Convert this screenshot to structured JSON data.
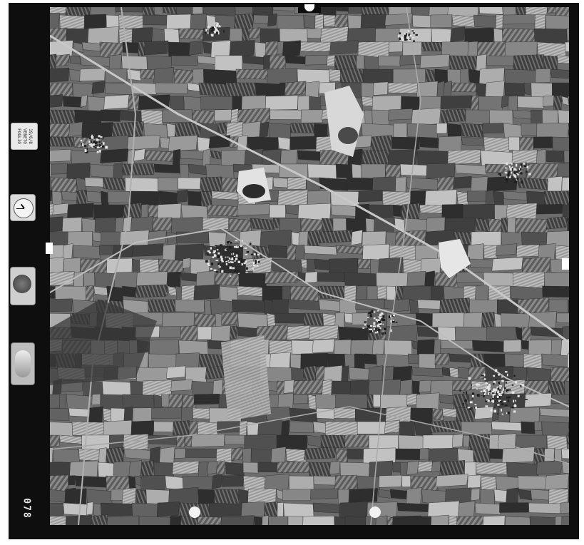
{
  "photo": {
    "frame_number": "078",
    "label_lines": [
      "19/6/8",
      "VENETO",
      "FOGLIO"
    ],
    "clock_time": {
      "hour": 10,
      "minute": 45
    }
  }
}
